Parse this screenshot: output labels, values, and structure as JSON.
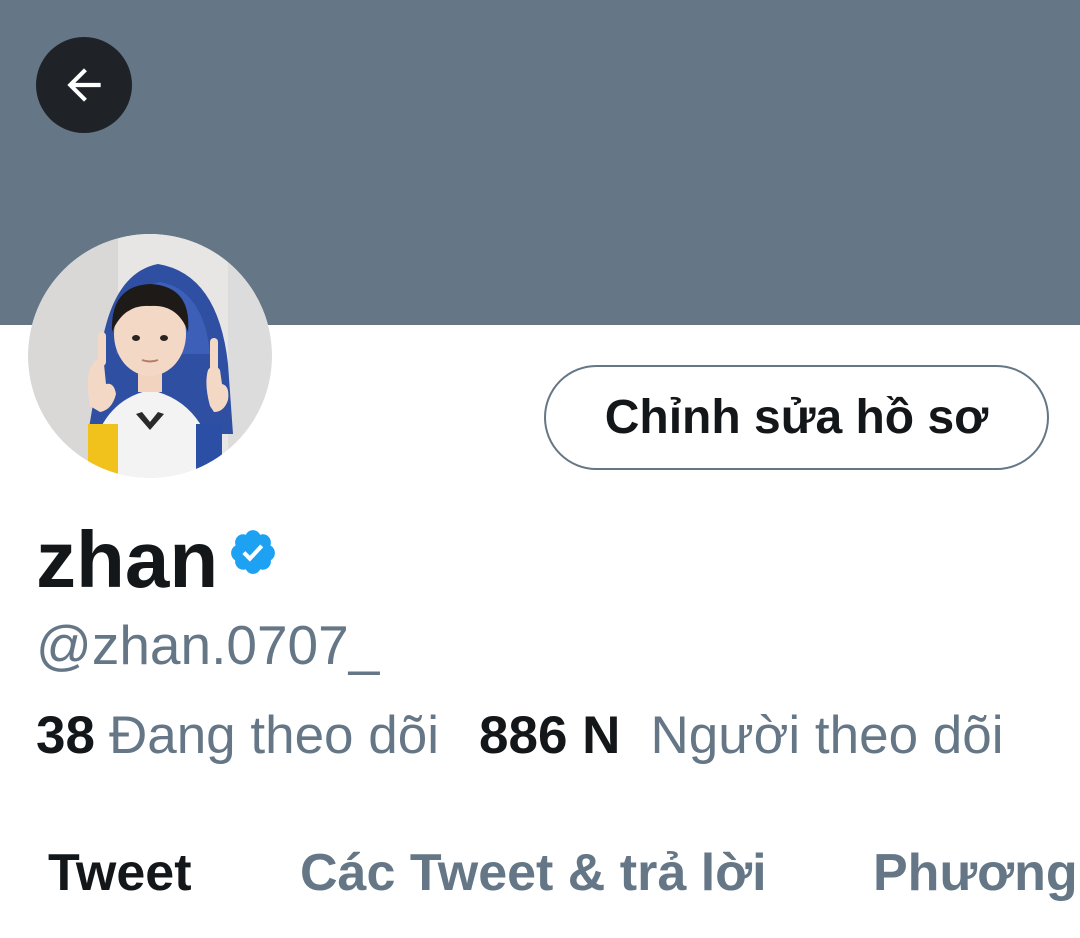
{
  "header": {
    "back_icon": "arrow-left-icon",
    "banner_color": "#657786"
  },
  "profile": {
    "avatar_icon": "avatar-photo",
    "edit_button_label": "Chỉnh sửa hồ sơ",
    "display_name": "zhan",
    "verified_icon": "verified-badge-icon",
    "verified_color": "#1da1f2",
    "handle": "@zhan.0707_"
  },
  "stats": {
    "following_count": "38",
    "following_label": "Đang theo dõi",
    "followers_count": "886 N",
    "followers_label": "Người theo dõi"
  },
  "tabs": [
    {
      "label": "Tweet",
      "active": true
    },
    {
      "label": "Các Tweet & trả lời",
      "active": false
    },
    {
      "label": "Phương",
      "active": false
    }
  ],
  "colors": {
    "text_primary": "#14171a",
    "text_secondary": "#657786"
  }
}
